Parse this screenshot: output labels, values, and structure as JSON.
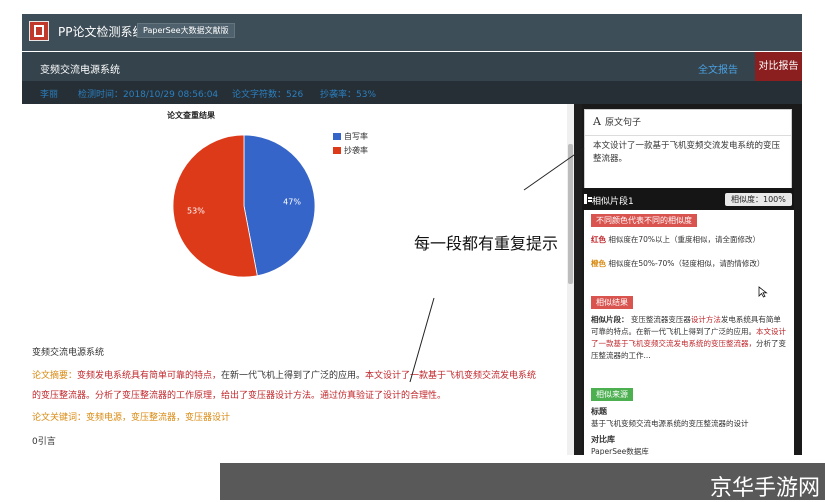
{
  "topbar": {
    "app_title": "PP论文检测系统",
    "badge": "PaperSee大数据文献版"
  },
  "navbar": {
    "doc_title": "变频交流电源系统",
    "link_full": "全文报告",
    "btn_compare": "对比报告"
  },
  "infobar": {
    "author": "李丽",
    "check_time": "检测时间：2018/10/29 08:56:04",
    "word_count": "论文字符数：526",
    "plagiarism_rate": "抄袭率：53%"
  },
  "chart_data": {
    "type": "pie",
    "title": "论文查重结果",
    "labels": [
      "自写率",
      "抄袭率"
    ],
    "values": [
      47,
      53
    ],
    "value_labels": [
      "47%",
      "53%"
    ],
    "colors": [
      "#3565c8",
      "#dd3a1a"
    ],
    "legend_position": "right"
  },
  "annotation": {
    "text": "每一段都有重复提示"
  },
  "document": {
    "section_title": "变频交流电源系统",
    "abstract_label": "论文摘要：",
    "abstract_line1_a": "变频发电系统具有简单可靠的特点，",
    "abstract_line1_b": "在新一代飞机上得到了广泛的应用。",
    "abstract_line1_c": "本文设计了一款基于飞机变频交流发电系统",
    "abstract_line2": "的变压整流器。分析了变压整流器的工作原理，给出了变压器设计方法。通过仿真验证了设计的合理性。",
    "keywords": "论文关键词：变频电源，变压整流器，变压器设计",
    "intro": "0引言"
  },
  "original_box": {
    "head": "原文句子",
    "icon": "A",
    "body": "本文设计了一款基于飞机变频交流发电系统的变压整流器。"
  },
  "similar_box": {
    "title": "相似片段1",
    "rate": "相似度：100%",
    "color_tag": "不同颜色代表不同的相似度",
    "red_label": "红色",
    "red_desc": "相似度在70%以上（重度相似，请全面修改）",
    "orange_label": "橙色",
    "orange_desc": "相似度在50%-70%（轻度相似，请酌情修改）",
    "result_tag": "相似结果",
    "result_label": "相似片段：",
    "result_text_a": "变压整流器变压器",
    "result_text_b": "设计方法",
    "result_text_c": "发电系统具有简单可靠的特点。在新一代飞机上得到了广泛的应用。",
    "result_text_d": "本文设计了一款基于飞机变频交流发电系统的变压整流器，",
    "result_text_e": "分析了变压整流器的工作...",
    "source_tag": "相似来源",
    "source_title_label": "标题",
    "source_title": "基于飞机变频交流电源系统的变压整流器的设计",
    "source_db_label": "对比库",
    "source_db": "PaperSee数据库"
  },
  "watermark": {
    "text": "京华手游网"
  }
}
